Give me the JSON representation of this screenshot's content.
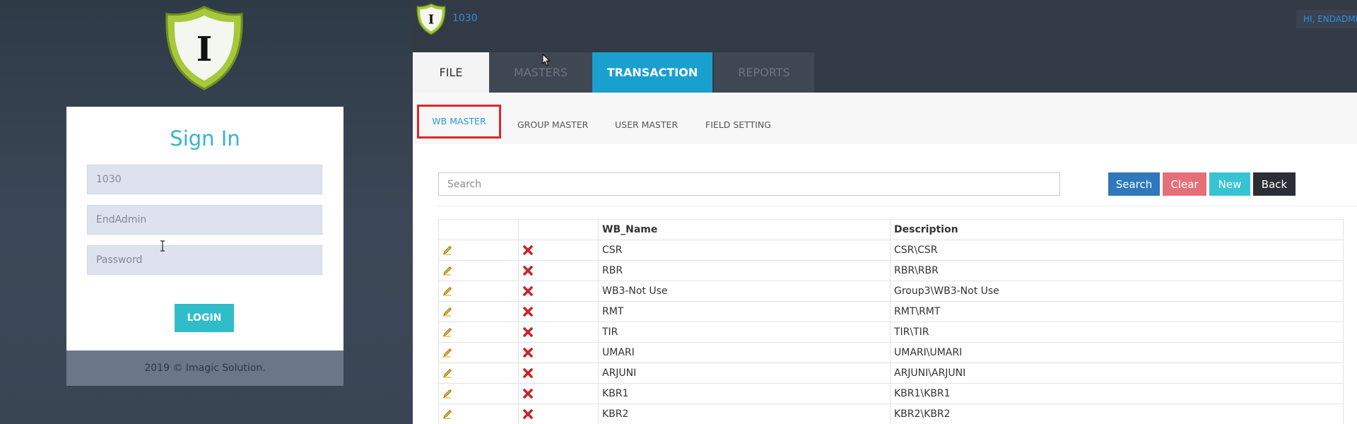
{
  "login": {
    "title": "Sign In",
    "company_value": "1030",
    "user_placeholder": "EndAdmin",
    "password_placeholder": "Password",
    "login_label": "LOGIN",
    "footer": "2019 © Imagic Solution."
  },
  "header": {
    "company_code": "1030",
    "greeting": "HI, ENDADMIN"
  },
  "main_tabs": [
    {
      "label": "FILE"
    },
    {
      "label": "MASTERS"
    },
    {
      "label": "TRANSACTION"
    },
    {
      "label": "REPORTS"
    }
  ],
  "sub_tabs": [
    {
      "label": "WB MASTER"
    },
    {
      "label": "GROUP MASTER"
    },
    {
      "label": "USER MASTER"
    },
    {
      "label": "FIELD SETTING"
    }
  ],
  "toolbar": {
    "search_placeholder": "Search",
    "search_label": "Search",
    "clear_label": "Clear",
    "new_label": "New",
    "back_label": "Back"
  },
  "grid": {
    "columns": [
      "",
      "",
      "WB_Name",
      "Description"
    ],
    "rows": [
      {
        "name": "CSR",
        "description": "CSR\\CSR"
      },
      {
        "name": "RBR",
        "description": "RBR\\RBR"
      },
      {
        "name": "WB3-Not Use",
        "description": "Group3\\WB3-Not Use"
      },
      {
        "name": "RMT",
        "description": "RMT\\RMT"
      },
      {
        "name": "TIR",
        "description": "TIR\\TIR"
      },
      {
        "name": "UMARI",
        "description": "UMARI\\UMARI"
      },
      {
        "name": "ARJUNI",
        "description": "ARJUNI\\ARJUNI"
      },
      {
        "name": "KBR1",
        "description": "KBR1\\KBR1"
      },
      {
        "name": "KBR2",
        "description": "KBR2\\KBR2"
      }
    ],
    "icons": {
      "edit": "pencil-icon",
      "delete": "delete-x-icon"
    }
  },
  "colors": {
    "accent": "#36b6c8",
    "transaction_tab": "#19a0cf",
    "search_button": "#2e78bb",
    "clear_button": "#e5707a",
    "new_button": "#36c4d4",
    "back_button": "#2b2f35",
    "highlight_border": "#e0262b"
  }
}
